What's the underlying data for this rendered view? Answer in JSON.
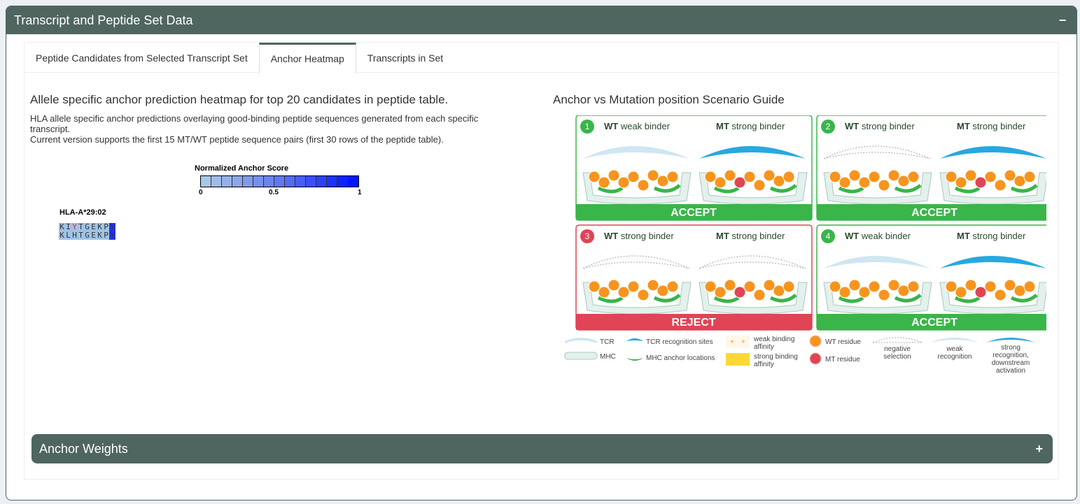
{
  "box": {
    "title": "Transcript and Peptide Set Data",
    "collapse": "−"
  },
  "tabs": [
    {
      "label": "Peptide Candidates from Selected Transcript Set"
    },
    {
      "label": "Anchor Heatmap"
    },
    {
      "label": "Transcripts in Set"
    }
  ],
  "left": {
    "title": "Allele specific anchor prediction heatmap for top 20 candidates in peptide table.",
    "desc1": "HLA allele specific anchor predictions overlaying good-binding peptide sequences generated from each specific transcript.",
    "desc2": "Current version supports the first 15 MT/WT peptide sequence pairs (first 30 rows of the peptide table).",
    "legend_title": "Normalized Anchor Score",
    "legend_ticks": [
      "0",
      "0.5",
      "1"
    ],
    "legend_colors": [
      "#a9c6e8",
      "#9fbce8",
      "#95b1e8",
      "#8ba6e9",
      "#809bea",
      "#7690ec",
      "#6b84ee",
      "#6078f0",
      "#546bf2",
      "#475ef4",
      "#3a50f6",
      "#2c42f8",
      "#1d33fa",
      "#0e24fd",
      "#0018ff"
    ],
    "allele": "HLA-A*29:02",
    "peptides": [
      {
        "letters": [
          "K",
          "I",
          "Y",
          "T",
          "G",
          "E",
          "K",
          "P",
          "Y"
        ],
        "colors": [
          "#9fc3e8",
          "#9fc3e8",
          "#9fc3e8",
          "#9fc3e8",
          "#9fc3e8",
          "#9fc3e8",
          "#9fc3e8",
          "#9fc3e8",
          "#2233e8"
        ],
        "text_colors": [
          "#333",
          "#333",
          "#d33",
          "#333",
          "#333",
          "#333",
          "#333",
          "#333",
          "#333"
        ]
      },
      {
        "letters": [
          "K",
          "L",
          "H",
          "T",
          "G",
          "E",
          "K",
          "P",
          "Y"
        ],
        "colors": [
          "#9fc3e8",
          "#9fc3e8",
          "#9fc3e8",
          "#9fc3e8",
          "#9fc3e8",
          "#9fc3e8",
          "#9fc3e8",
          "#9fc3e8",
          "#2233e8"
        ],
        "text_colors": [
          "#333",
          "#333",
          "#333",
          "#333",
          "#333",
          "#333",
          "#333",
          "#333",
          "#333"
        ]
      }
    ]
  },
  "right": {
    "title": "Anchor vs Mutation position Scenario Guide",
    "scenarios": [
      {
        "num": "1",
        "wt": "WT",
        "wt_text": " weak binder",
        "mt": "MT",
        "mt_text": " strong binder",
        "verdict": "ACCEPT",
        "color": "#3ab54a"
      },
      {
        "num": "2",
        "wt": "WT",
        "wt_text": " strong binder",
        "mt": "MT",
        "mt_text": " strong binder",
        "verdict": "ACCEPT",
        "color": "#3ab54a"
      },
      {
        "num": "3",
        "wt": "WT",
        "wt_text": " strong binder",
        "mt": "MT",
        "mt_text": " strong binder",
        "verdict": "REJECT",
        "color": "#e04455"
      },
      {
        "num": "4",
        "wt": "WT",
        "wt_text": " weak binder",
        "mt": "MT",
        "mt_text": " strong binder",
        "verdict": "ACCEPT",
        "color": "#3ab54a"
      }
    ],
    "legend": {
      "tcr": "TCR",
      "mhc": "MHC",
      "tcr_sites": "TCR recognition sites",
      "mhc_anchor": "MHC anchor locations",
      "weak_aff_1": "weak binding",
      "weak_aff_2": "affinity",
      "strong_aff_1": "strong binding",
      "strong_aff_2": "affinity",
      "wt_res": "WT residue",
      "mt_res": "MT residue",
      "neg_1": "negative",
      "neg_2": "selection",
      "weak_rec_1": "weak",
      "weak_rec_2": "recognition",
      "strong_rec_1": "strong",
      "strong_rec_2": "recognition,",
      "strong_rec_3": "downstream",
      "strong_rec_4": "activation"
    }
  },
  "anchor_weights": {
    "title": "Anchor Weights",
    "expand": "+"
  }
}
